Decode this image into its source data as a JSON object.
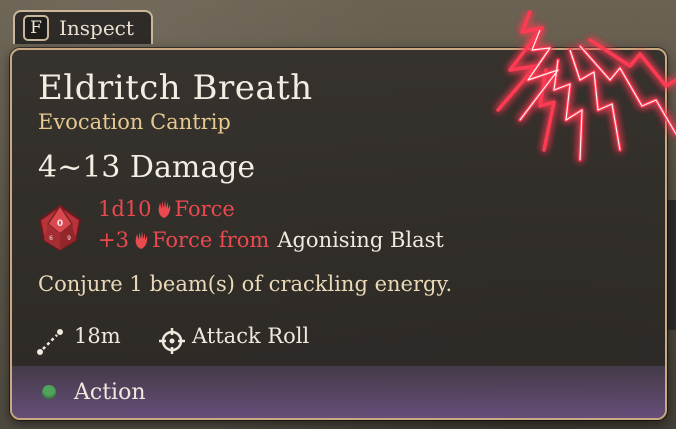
{
  "inspect_tab": {
    "key": "F",
    "label": "Inspect"
  },
  "spell": {
    "name": "Eldritch Breath",
    "school_level": "Evocation Cantrip",
    "damage_range": "4~13 Damage",
    "damage_lines": [
      {
        "dice": "1d10",
        "type": "Force",
        "source": ""
      },
      {
        "dice": "+3",
        "type": "Force from",
        "source": "Agonising Blast"
      }
    ],
    "description": "Conjure 1 beam(s) of crackling energy.",
    "range": "18m",
    "roll_type": "Attack Roll",
    "cost": "Action"
  },
  "colors": {
    "damage_red": "#ea4a4f",
    "subtitle_gold": "#e6c98f",
    "action_green": "#4fa35a",
    "border": "#c9a981"
  },
  "icons": [
    "d10-dice-icon",
    "force-hand-icon",
    "range-icon",
    "target-icon",
    "eldritch-blast-art"
  ]
}
